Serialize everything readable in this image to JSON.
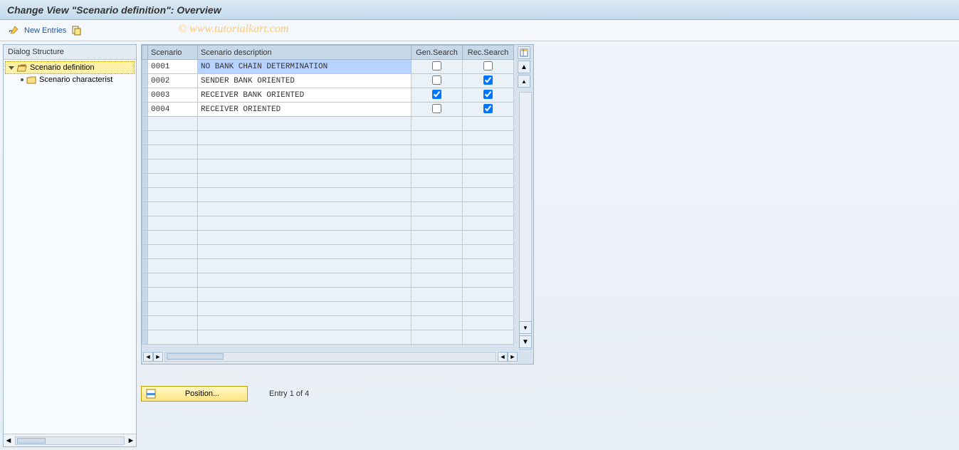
{
  "window": {
    "title": "Change View \"Scenario definition\": Overview"
  },
  "watermark": "© www.tutorialkart.com",
  "toolbar": {
    "change_tooltip": "Display/Change",
    "new_entries_label": "New Entries",
    "copy_tooltip": "Copy As"
  },
  "sidebar": {
    "title": "Dialog Structure",
    "items": [
      {
        "label": "Scenario definition",
        "selected": true,
        "icon": "folder-open-icon"
      },
      {
        "label": "Scenario characterist",
        "selected": false,
        "icon": "folder-icon"
      }
    ]
  },
  "grid": {
    "headers": {
      "scenario": "Scenario",
      "description": "Scenario description",
      "gen": "Gen.Search",
      "rec": "Rec.Search"
    },
    "rows": [
      {
        "scenario": "0001",
        "description": "NO BANK CHAIN DETERMINATION",
        "gen": false,
        "rec": false
      },
      {
        "scenario": "0002",
        "description": "SENDER BANK ORIENTED",
        "gen": false,
        "rec": true
      },
      {
        "scenario": "0003",
        "description": "RECEIVER BANK ORIENTED",
        "gen": true,
        "rec": true
      },
      {
        "scenario": "0004",
        "description": "RECEIVER ORIENTED",
        "gen": false,
        "rec": true
      }
    ],
    "empty_rows": 16,
    "config_tooltip": "Configuration"
  },
  "footer": {
    "position_label": "Position...",
    "entry_text": "Entry 1 of 4"
  },
  "icons": {
    "pencil": "pencil-icon",
    "copy": "copy-icon",
    "folder_open": "folder-open-icon",
    "folder": "folder-icon",
    "table_settings": "table-settings-icon",
    "scroll_up": "scroll-up-icon",
    "scroll_down": "scroll-down-icon"
  }
}
